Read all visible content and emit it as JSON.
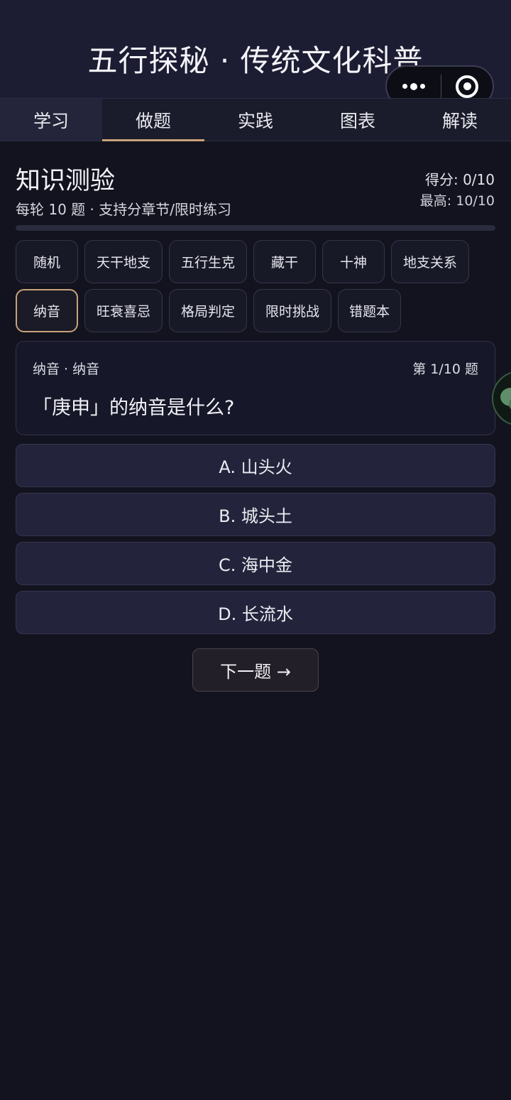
{
  "header": {
    "title": "五行探秘 · 传统文化科普",
    "capsule": {
      "more_icon": "more-dots-icon",
      "target_icon": "target-icon"
    }
  },
  "tabs": [
    {
      "label": "学习"
    },
    {
      "label": "做题"
    },
    {
      "label": "实践"
    },
    {
      "label": "图表"
    },
    {
      "label": "解读"
    }
  ],
  "active_tab": "做题",
  "quiz": {
    "title": "知识测验",
    "subtitle": "每轮 10 题 · 支持分章节/限时练习",
    "score": "得分: 0/10",
    "best": "最高: 10/10",
    "progress": 0
  },
  "chips_row1": [
    "随机",
    "天干地支",
    "五行生克",
    "藏干",
    "十神",
    "地支关系"
  ],
  "chips_row2": [
    "纳音",
    "旺衰喜忌",
    "格局判定",
    "限时挑战",
    "错题本"
  ],
  "selected_chip": "纳音",
  "question": {
    "category": "纳音 · 纳音",
    "number": "第 1/10 题",
    "text": "「庚申」的纳音是什么?"
  },
  "options": [
    {
      "label": "A. 山头火"
    },
    {
      "label": "B. 城头土"
    },
    {
      "label": "C. 海中金"
    },
    {
      "label": "D. 长流水"
    }
  ],
  "next_button": "下一题 →",
  "colors": {
    "accent": "#c9a27a",
    "background": "#13131f",
    "header": "#1c1d33",
    "option": "#23243c"
  },
  "float_icon": "chat-bubble-icon"
}
